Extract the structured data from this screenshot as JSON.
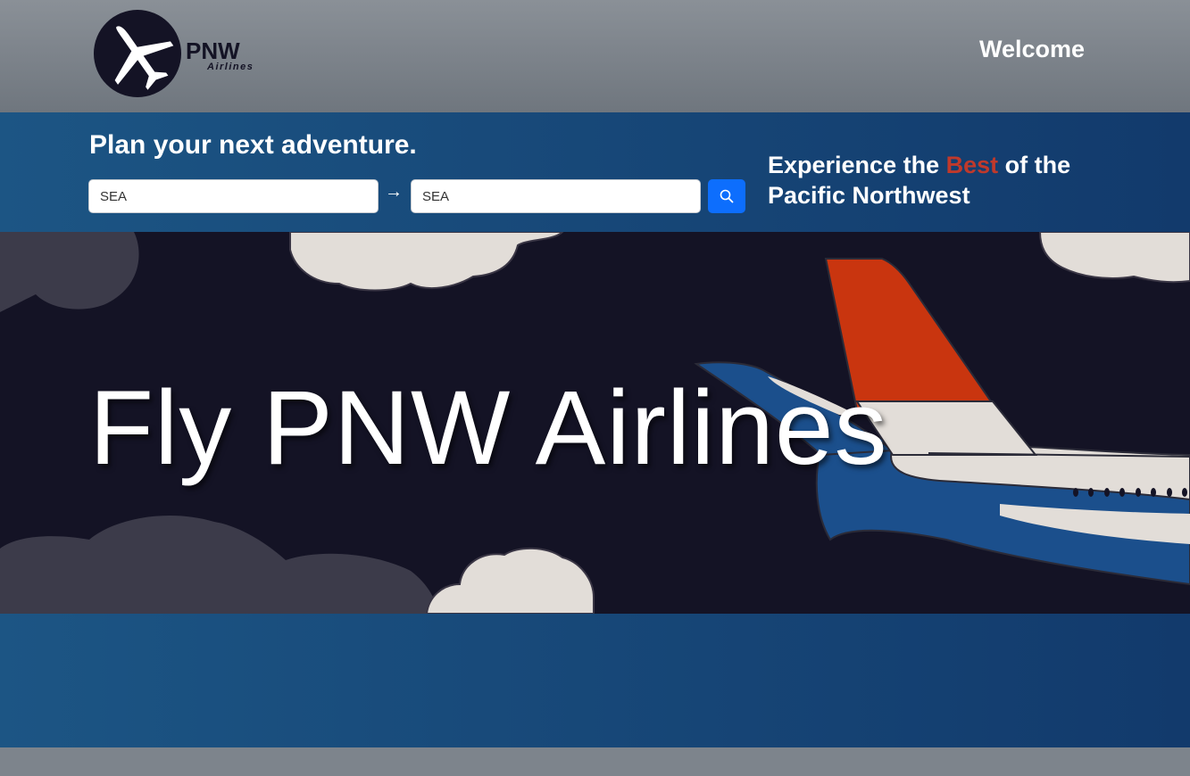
{
  "header": {
    "logo_name": "PNW",
    "logo_sub": "Airlines",
    "welcome": "Welcome"
  },
  "search": {
    "title": "Plan your next adventure.",
    "from_value": "SEA",
    "to_value": "SEA",
    "arrow": "→",
    "button_icon": "search-icon",
    "button_color": "#0d6efd"
  },
  "tagline": {
    "part1": "Experience the ",
    "accent": "Best",
    "part2": " of the Pacific Northwest",
    "accent_color": "#c0392b"
  },
  "hero": {
    "title": "Fly PNW Airlines"
  },
  "colors": {
    "band": "#1c5584",
    "hero_bg": "#141325",
    "header_bg": "#7d848c"
  }
}
